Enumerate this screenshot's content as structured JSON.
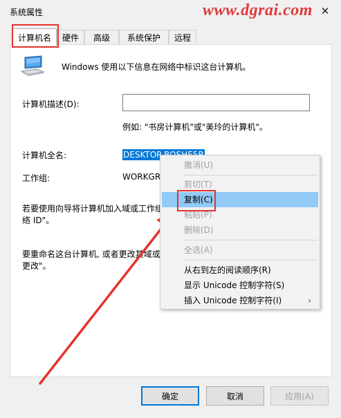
{
  "window": {
    "title": "系统属性"
  },
  "watermark": "www.dgrai.com",
  "tabs": [
    {
      "label": "计算机名",
      "active": true
    },
    {
      "label": "硬件"
    },
    {
      "label": "高级"
    },
    {
      "label": "系统保护"
    },
    {
      "label": "远程"
    }
  ],
  "panel": {
    "intro": "Windows 使用以下信息在网络中标识这台计算机。",
    "description_label": "计算机描述(D):",
    "description_value": "",
    "example": "例如: \"书房计算机\"或\"美玲的计算机\"。",
    "full_name_label": "计算机全名:",
    "full_name_value": "DESKTOP-BOSHE5R",
    "workgroup_label": "工作组:",
    "workgroup_value": "WORKGR",
    "domain_text_1": "若要使用向导将计算机加入域或工作组",
    "domain_text_2": "络 ID\"。",
    "rename_text_1": "要重命名这台计算机, 或者更改其域或",
    "rename_text_2": "更改\"。"
  },
  "context_menu": {
    "items": [
      {
        "label": "撤消(U)",
        "disabled": true
      },
      {
        "label": "剪切(T)",
        "disabled": true
      },
      {
        "label": "复制(C)",
        "hover": true
      },
      {
        "label": "粘贴(P)",
        "disabled": true
      },
      {
        "label": "删除(D)",
        "disabled": true
      },
      {
        "label": "全选(A)",
        "disabled": true
      },
      {
        "label": "从右到左的阅读顺序(R)"
      },
      {
        "label": "显示 Unicode 控制字符(S)"
      },
      {
        "label": "插入 Unicode 控制字符(I)",
        "submenu": true
      }
    ]
  },
  "buttons": {
    "ok": "确定",
    "cancel": "取消",
    "apply": "应用(A)"
  },
  "colors": {
    "annotation_red": "#e5322d",
    "selection_blue": "#0078d7",
    "menu_hover": "#91c9f7"
  }
}
